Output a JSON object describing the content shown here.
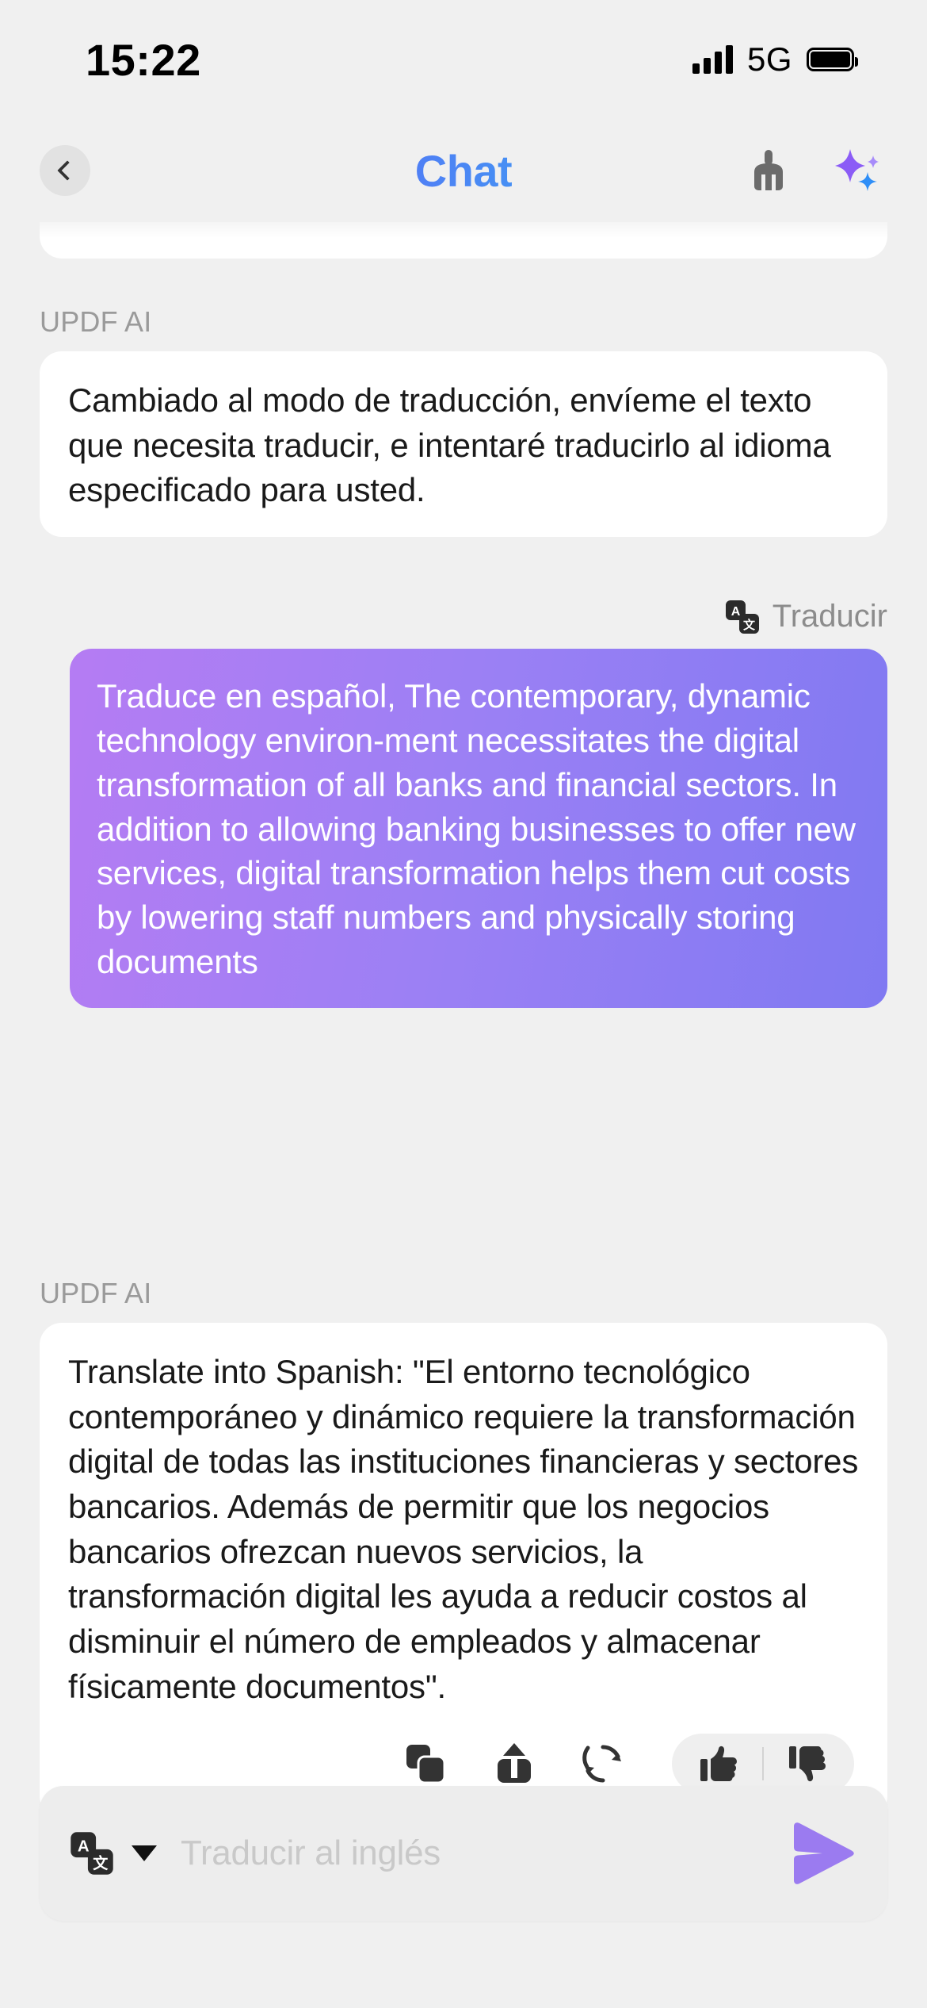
{
  "status_bar": {
    "time": "15:22",
    "network": "5G",
    "signal_icon": "signal-bars-icon",
    "battery_icon": "battery-full-icon"
  },
  "header": {
    "title": "Chat",
    "back_icon": "chevron-left-icon",
    "clear_icon": "broom-icon",
    "ai_icon": "sparkles-icon",
    "title_gradient_start": "#8B5CF6",
    "title_gradient_end": "#22D3EE"
  },
  "conversation": {
    "ai_sender_label": "UPDF AI",
    "messages": [
      {
        "role": "assistant",
        "sender": "UPDF AI",
        "text": "Cambiado al modo de traducción, envíeme el texto que necesita traducir, e intentaré traducirlo al idioma especificado para usted."
      },
      {
        "role": "user",
        "tag": "Traducir",
        "tag_icon": "translate-icon",
        "text": "Traduce en español, The contemporary, dynamic technology environ-ment necessitates the digital transformation of all banks and financial sectors. In addition to allowing banking businesses to offer new services, digital transformation helps them cut costs by lowering staff numbers and physically storing documents"
      },
      {
        "role": "assistant",
        "sender": "UPDF AI",
        "text": "Translate into Spanish: \"El entorno tecnológico contemporáneo y dinámico requiere la transformación digital de todas las instituciones financieras y sectores bancarios. Además de permitir que los negocios bancarios ofrezcan nuevos servicios, la transformación digital les ayuda a reducir costos al disminuir el número de empleados y almacenar físicamente documentos\"."
      }
    ],
    "message_actions": {
      "copy_icon": "copy-icon",
      "share_icon": "share-upload-icon",
      "regenerate_icon": "refresh-icon",
      "thumbs_up_icon": "thumbs-up-icon",
      "thumbs_down_icon": "thumbs-down-icon"
    }
  },
  "input_bar": {
    "mode_icon": "translate-icon",
    "dropdown_icon": "caret-down-icon",
    "placeholder": "Traducir al inglés",
    "value": "",
    "send_icon": "send-icon",
    "send_color": "#9B7BF0"
  }
}
